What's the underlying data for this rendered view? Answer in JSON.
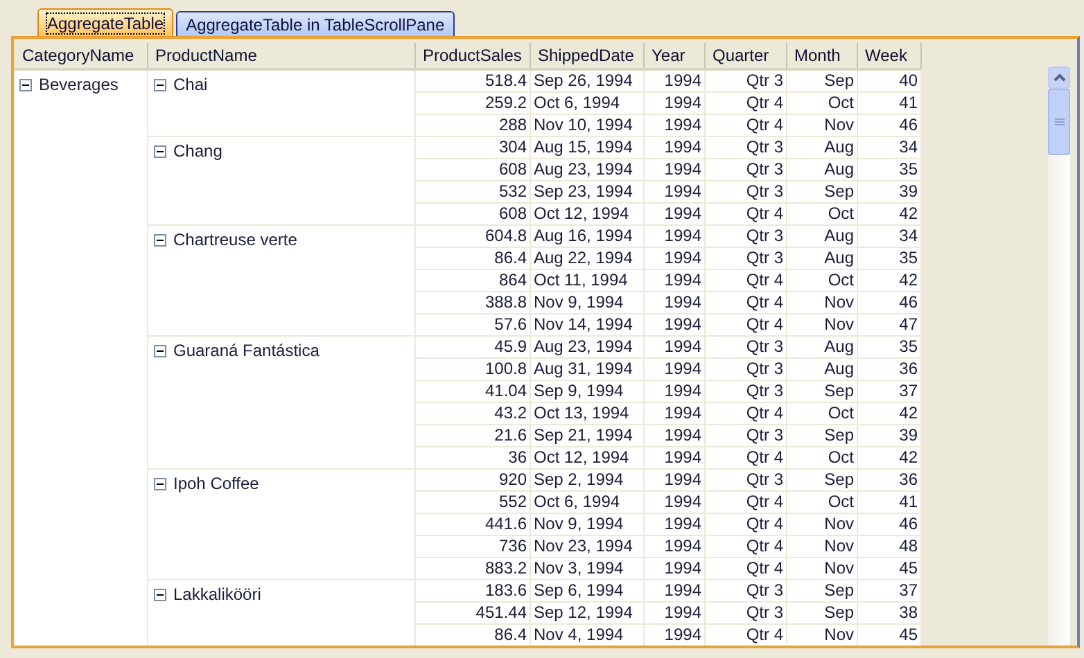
{
  "tabs": [
    {
      "label": "AggregateTable",
      "selected": true
    },
    {
      "label": "AggregateTable in TableScrollPane",
      "selected": false
    }
  ],
  "table": {
    "columns": [
      "CategoryName",
      "ProductName",
      "ProductSales",
      "ShippedDate",
      "Year",
      "Quarter",
      "Month",
      "Week"
    ],
    "categories": [
      {
        "name": "Beverages",
        "expanded": true,
        "products": [
          {
            "name": "Chai",
            "expanded": true,
            "rows": [
              [
                "518.4",
                "Sep 26, 1994",
                "1994",
                "Qtr 3",
                "Sep",
                "40"
              ],
              [
                "259.2",
                "Oct 6, 1994",
                "1994",
                "Qtr 4",
                "Oct",
                "41"
              ],
              [
                "288",
                "Nov 10, 1994",
                "1994",
                "Qtr 4",
                "Nov",
                "46"
              ]
            ]
          },
          {
            "name": "Chang",
            "expanded": true,
            "rows": [
              [
                "304",
                "Aug 15, 1994",
                "1994",
                "Qtr 3",
                "Aug",
                "34"
              ],
              [
                "608",
                "Aug 23, 1994",
                "1994",
                "Qtr 3",
                "Aug",
                "35"
              ],
              [
                "532",
                "Sep 23, 1994",
                "1994",
                "Qtr 3",
                "Sep",
                "39"
              ],
              [
                "608",
                "Oct 12, 1994",
                "1994",
                "Qtr 4",
                "Oct",
                "42"
              ]
            ]
          },
          {
            "name": "Chartreuse verte",
            "expanded": true,
            "rows": [
              [
                "604.8",
                "Aug 16, 1994",
                "1994",
                "Qtr 3",
                "Aug",
                "34"
              ],
              [
                "86.4",
                "Aug 22, 1994",
                "1994",
                "Qtr 3",
                "Aug",
                "35"
              ],
              [
                "864",
                "Oct 11, 1994",
                "1994",
                "Qtr 4",
                "Oct",
                "42"
              ],
              [
                "388.8",
                "Nov 9, 1994",
                "1994",
                "Qtr 4",
                "Nov",
                "46"
              ],
              [
                "57.6",
                "Nov 14, 1994",
                "1994",
                "Qtr 4",
                "Nov",
                "47"
              ]
            ]
          },
          {
            "name": "Guaraná Fantástica",
            "expanded": true,
            "rows": [
              [
                "45.9",
                "Aug 23, 1994",
                "1994",
                "Qtr 3",
                "Aug",
                "35"
              ],
              [
                "100.8",
                "Aug 31, 1994",
                "1994",
                "Qtr 3",
                "Aug",
                "36"
              ],
              [
                "41.04",
                "Sep 9, 1994",
                "1994",
                "Qtr 3",
                "Sep",
                "37"
              ],
              [
                "43.2",
                "Oct 13, 1994",
                "1994",
                "Qtr 4",
                "Oct",
                "42"
              ],
              [
                "21.6",
                "Sep 21, 1994",
                "1994",
                "Qtr 3",
                "Sep",
                "39"
              ],
              [
                "36",
                "Oct 12, 1994",
                "1994",
                "Qtr 4",
                "Oct",
                "42"
              ]
            ]
          },
          {
            "name": "Ipoh Coffee",
            "expanded": true,
            "rows": [
              [
                "920",
                "Sep 2, 1994",
                "1994",
                "Qtr 3",
                "Sep",
                "36"
              ],
              [
                "552",
                "Oct 6, 1994",
                "1994",
                "Qtr 4",
                "Oct",
                "41"
              ],
              [
                "441.6",
                "Nov 9, 1994",
                "1994",
                "Qtr 4",
                "Nov",
                "46"
              ],
              [
                "736",
                "Nov 23, 1994",
                "1994",
                "Qtr 4",
                "Nov",
                "48"
              ],
              [
                "883.2",
                "Nov 3, 1994",
                "1994",
                "Qtr 4",
                "Nov",
                "45"
              ]
            ]
          },
          {
            "name": "Lakkalikööri",
            "expanded": true,
            "rows": [
              [
                "183.6",
                "Sep 6, 1994",
                "1994",
                "Qtr 3",
                "Sep",
                "37"
              ],
              [
                "451.44",
                "Sep 12, 1994",
                "1994",
                "Qtr 3",
                "Sep",
                "38"
              ],
              [
                "86.4",
                "Nov 4, 1994",
                "1994",
                "Qtr 4",
                "Nov",
                "45"
              ]
            ]
          }
        ]
      }
    ]
  }
}
